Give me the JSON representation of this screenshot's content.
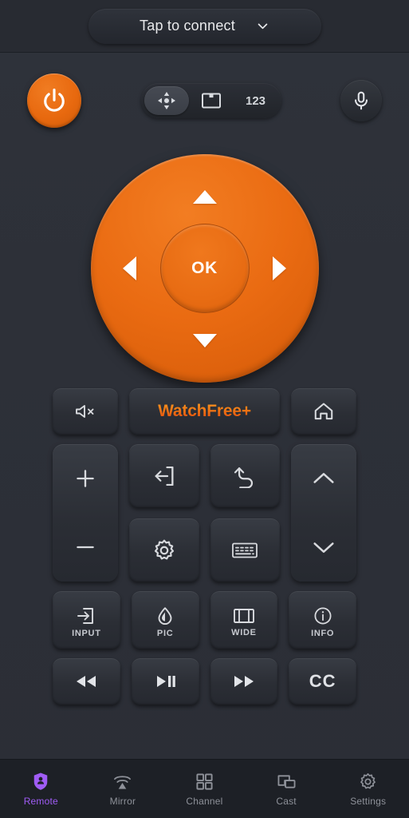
{
  "app": {
    "accent_orange": "#e8690f",
    "accent_purple": "#a05cf5",
    "background": "#2d3038",
    "button_fill": "#31353d"
  },
  "topbar": {
    "connect_label": "Tap to connect",
    "chevron_icon": "chevron-down-icon"
  },
  "controls": {
    "power_label": "Power",
    "power_icon": "power-icon",
    "mic_label": "Voice",
    "mic_icon": "microphone-icon",
    "modes": [
      {
        "id": "dpad",
        "label": "",
        "icon": "dpad-move-icon",
        "active": true
      },
      {
        "id": "screen",
        "label": "",
        "icon": "screen-icon",
        "active": false
      },
      {
        "id": "numeric",
        "label": "123",
        "icon": "number-pad",
        "active": false
      }
    ]
  },
  "dpad": {
    "ok_label": "OK",
    "up_icon": "arrow-up-icon",
    "down_icon": "arrow-down-icon",
    "left_icon": "arrow-left-icon",
    "right_icon": "arrow-right-icon"
  },
  "quick_row": {
    "mute": {
      "label": "",
      "icon": "mute-icon"
    },
    "watchfree": {
      "label": "WatchFree+",
      "icon": "watchfree-brand"
    },
    "home": {
      "label": "",
      "icon": "home-icon"
    }
  },
  "rockers": {
    "volume": {
      "name": "volume",
      "up_icon": "plus-icon",
      "down_icon": "minus-icon"
    },
    "channel": {
      "name": "channel",
      "up_icon": "chevron-up-icon",
      "down_icon": "chevron-down-icon"
    }
  },
  "center_buttons": [
    {
      "id": "exit",
      "label": "",
      "icon": "exit-icon"
    },
    {
      "id": "back",
      "label": "",
      "icon": "back-arrow-icon"
    },
    {
      "id": "settings",
      "label": "",
      "icon": "gear-icon"
    },
    {
      "id": "keyboard",
      "label": "",
      "icon": "keyboard-icon"
    }
  ],
  "function_row": [
    {
      "id": "input",
      "label": "INPUT",
      "icon": "input-icon"
    },
    {
      "id": "pic",
      "label": "PIC",
      "icon": "droplet-icon"
    },
    {
      "id": "wide",
      "label": "WIDE",
      "icon": "wide-aspect-icon"
    },
    {
      "id": "info",
      "label": "INFO",
      "icon": "info-icon"
    }
  ],
  "media_row": [
    {
      "id": "rewind",
      "label": "",
      "icon": "rewind-icon"
    },
    {
      "id": "play-pause",
      "label": "",
      "icon": "play-pause-icon"
    },
    {
      "id": "fast-forward",
      "label": "",
      "icon": "fast-forward-icon"
    },
    {
      "id": "closed-caption",
      "label": "CC",
      "icon": "cc-icon"
    }
  ],
  "bottom_nav": {
    "active": "Remote",
    "items": [
      {
        "id": "remote",
        "label": "Remote",
        "icon": "remote-icon",
        "active": true
      },
      {
        "id": "mirror",
        "label": "Mirror",
        "icon": "screen-mirror-icon",
        "active": false
      },
      {
        "id": "channel",
        "label": "Channel",
        "icon": "grid-icon",
        "active": false
      },
      {
        "id": "cast",
        "label": "Cast",
        "icon": "cast-icon",
        "active": false
      },
      {
        "id": "settings",
        "label": "Settings",
        "icon": "gear-icon",
        "active": false
      }
    ]
  }
}
